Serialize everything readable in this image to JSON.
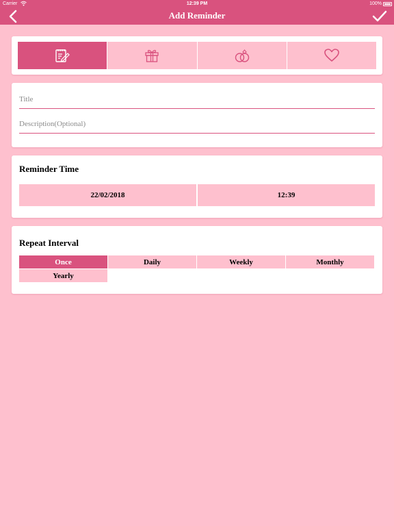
{
  "status_bar": {
    "carrier": "Carrier",
    "time": "12:39 PM",
    "battery": "100%"
  },
  "nav": {
    "title": "Add Reminder",
    "back_icon": "chevron-left-icon",
    "done_icon": "checkmark-icon"
  },
  "categories": [
    {
      "icon": "note-edit-icon",
      "selected": true
    },
    {
      "icon": "gift-icon",
      "selected": false
    },
    {
      "icon": "rings-icon",
      "selected": false
    },
    {
      "icon": "heart-icon",
      "selected": false
    }
  ],
  "form": {
    "title_placeholder": "Title",
    "title_value": "",
    "description_placeholder": "Description(Optional)",
    "description_value": ""
  },
  "reminder_time": {
    "heading": "Reminder Time",
    "date": "22/02/2018",
    "time": "12:39"
  },
  "repeat_interval": {
    "heading": "Repeat Interval",
    "options": [
      "Once",
      "Daily",
      "Weekly",
      "Monthly",
      "Yearly"
    ],
    "selected": "Once"
  },
  "colors": {
    "accent": "#d9527e",
    "light_pink": "#fec0ce",
    "card": "#ffffff"
  }
}
